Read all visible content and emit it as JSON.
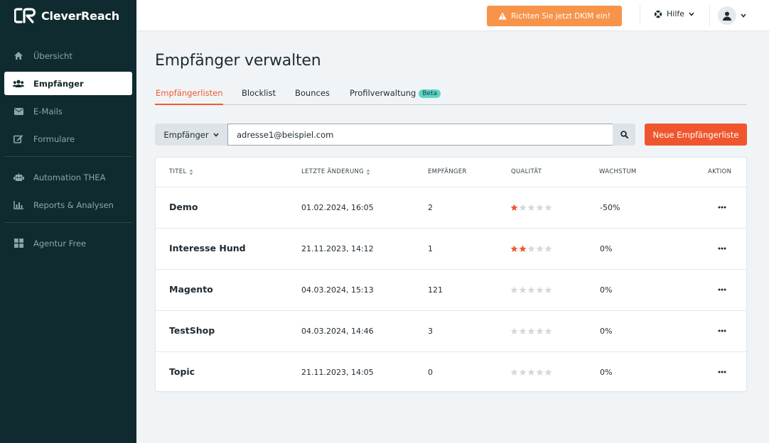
{
  "brand": {
    "name": "CleverReach"
  },
  "sidebar": {
    "items": [
      {
        "label": "Übersicht",
        "icon": "home-icon"
      },
      {
        "label": "Empfänger",
        "icon": "users-icon",
        "active": true
      },
      {
        "label": "E-Mails",
        "icon": "envelope-icon"
      },
      {
        "label": "Formulare",
        "icon": "edit-form-icon"
      },
      {
        "label": "Automation THEA",
        "icon": "robot-icon"
      },
      {
        "label": "Reports & Analysen",
        "icon": "bar-chart-icon"
      },
      {
        "label": "Agentur Free",
        "icon": "grid-icon"
      }
    ]
  },
  "topbar": {
    "dkim_label": "Richten Sie jetzt DKIM ein!",
    "help_label": "Hilfe"
  },
  "page": {
    "title": "Empfänger verwalten"
  },
  "tabs": [
    {
      "label": "Empfängerlisten",
      "active": true
    },
    {
      "label": "Blocklist"
    },
    {
      "label": "Bounces"
    },
    {
      "label": "Profilverwaltung",
      "badge": "Beta"
    }
  ],
  "search": {
    "scope_label": "Empfänger",
    "value": "adresse1@beispiel.com",
    "new_button_label": "Neue Empfängerliste"
  },
  "table": {
    "columns": [
      "TITEL",
      "LETZTE ÄNDERUNG",
      "EMPFÄNGER",
      "QUALITÄT",
      "WACHSTUM",
      "AKTION"
    ],
    "rows": [
      {
        "title": "Demo",
        "changed": "01.02.2024, 16:05",
        "recipients": "2",
        "quality": 1,
        "growth": "-50%"
      },
      {
        "title": "Interesse Hund",
        "changed": "21.11.2023, 14:12",
        "recipients": "1",
        "quality": 2,
        "growth": "0%"
      },
      {
        "title": "Magento",
        "changed": "04.03.2024, 15:13",
        "recipients": "121",
        "quality": 0,
        "growth": "0%"
      },
      {
        "title": "TestShop",
        "changed": "04.03.2024, 14:46",
        "recipients": "3",
        "quality": 0,
        "growth": "0%"
      },
      {
        "title": "Topic",
        "changed": "21.11.2023, 14:05",
        "recipients": "0",
        "quality": 0,
        "growth": "0%"
      }
    ]
  },
  "colors": {
    "sidebar_bg": "#0f2b2f",
    "accent": "#f0562d",
    "warning": "#f7944a",
    "star_filled": "#ee5a32",
    "star_empty": "#d3d9dc"
  }
}
